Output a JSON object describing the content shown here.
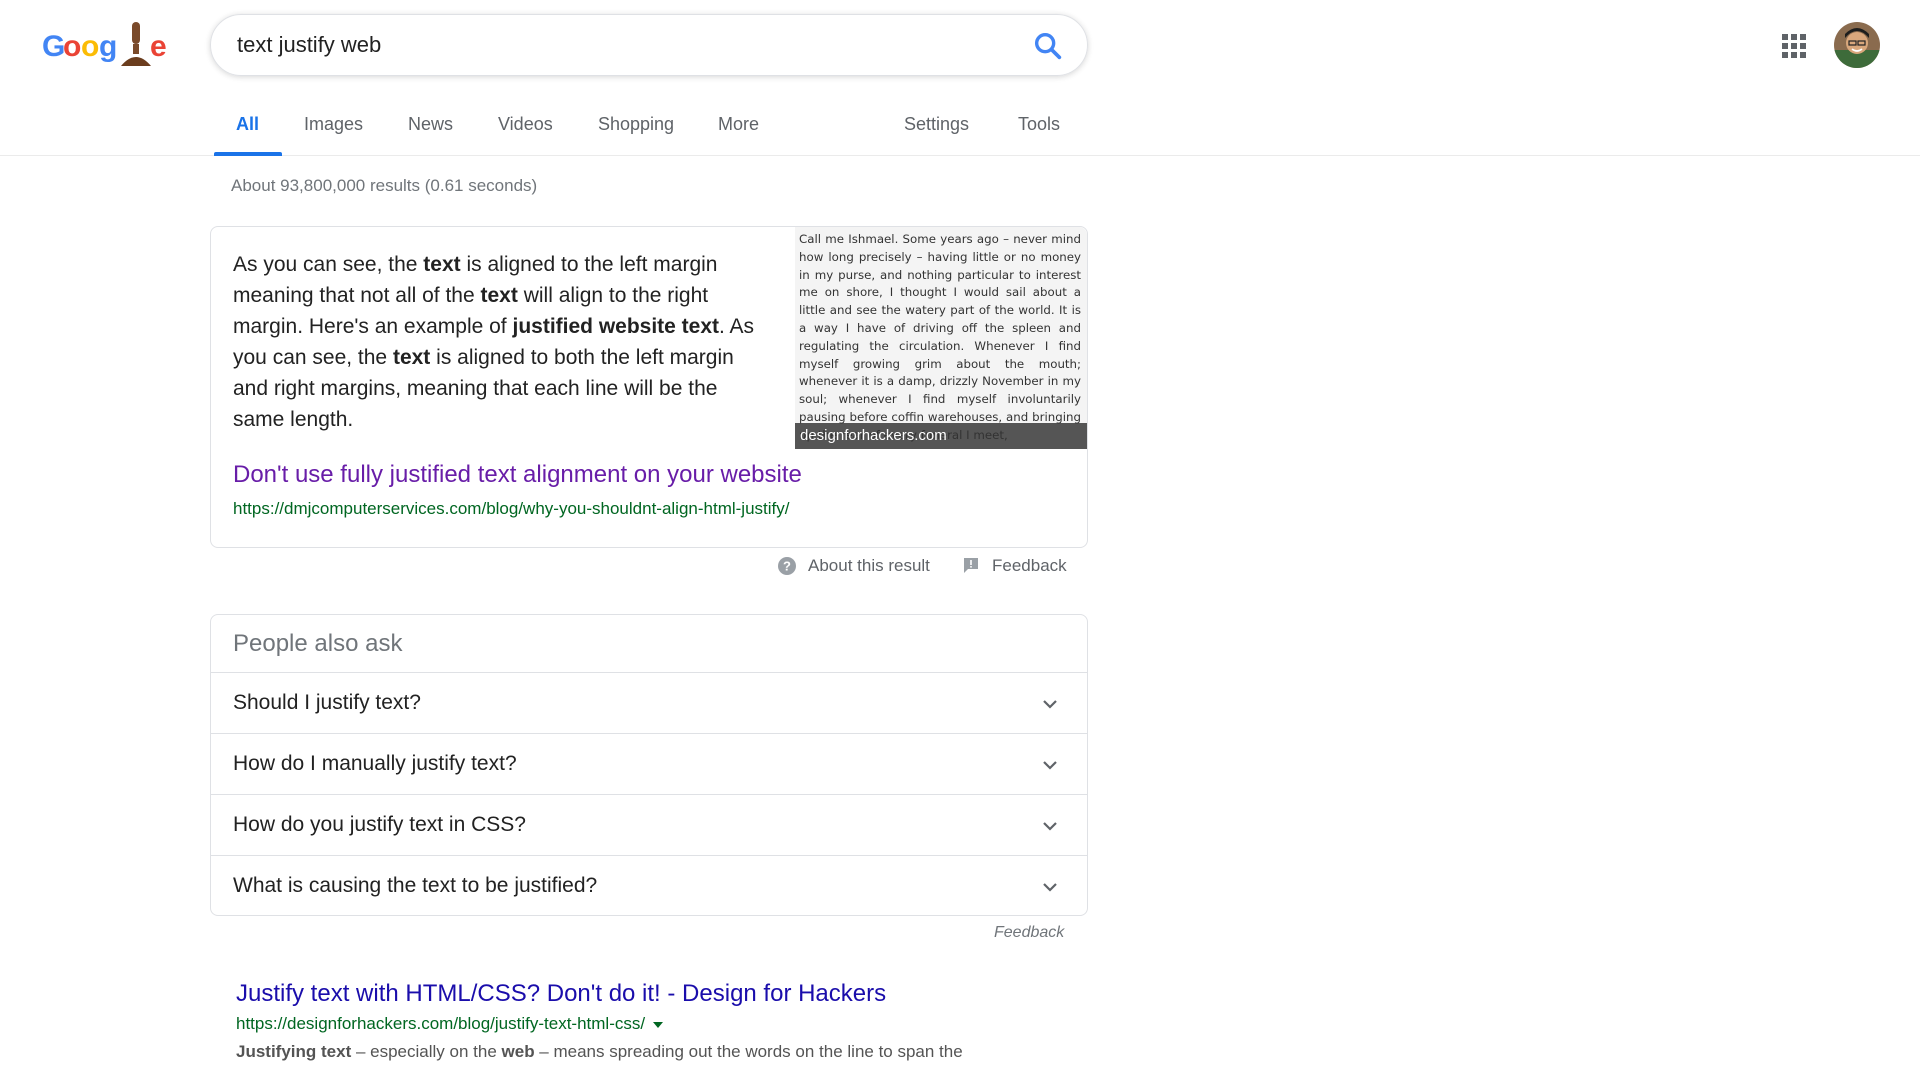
{
  "search": {
    "query": "text justify web"
  },
  "tabs": [
    {
      "label": "All"
    },
    {
      "label": "Images"
    },
    {
      "label": "News"
    },
    {
      "label": "Videos"
    },
    {
      "label": "Shopping"
    },
    {
      "label": "More"
    },
    {
      "label": "Settings"
    },
    {
      "label": "Tools"
    }
  ],
  "stats": "About 93,800,000 results (0.61 seconds)",
  "featured": {
    "parts": [
      {
        "text": "As you can see, the ",
        "bold": false
      },
      {
        "text": "text",
        "bold": true
      },
      {
        "text": " is aligned to the left margin meaning that not all of the ",
        "bold": false
      },
      {
        "text": "text",
        "bold": true
      },
      {
        "text": " will align to the right margin. Here's an example of ",
        "bold": false
      },
      {
        "text": "justified website text",
        "bold": true
      },
      {
        "text": ". As you can see, the ",
        "bold": false
      },
      {
        "text": "text",
        "bold": true
      },
      {
        "text": " is aligned to both the left margin and right margins, meaning that each line will be the same length.",
        "bold": false
      }
    ],
    "image_text": "Call me Ishmael. Some years ago – never mind how long precisely – having little or no money in my purse, and nothing particular to interest me on shore, I thought I would sail about a little and see the watery part of the world. It is a way I have of driving off the spleen and regulating the circulation. Whenever I find myself growing grim about the mouth; whenever it is a damp, drizzly November in my soul; whenever I find myself involuntarily pausing before coffin warehouses, and bringing up the rear of every funeral I meet,",
    "image_caption": "designforhackers.com",
    "title": "Don't use fully justified text alignment on your website",
    "url": "https://dmjcomputerservices.com/blog/why-you-shouldnt-align-html-justify/"
  },
  "about": {
    "about_label": "About this result",
    "feedback_label": "Feedback"
  },
  "paa": {
    "heading": "People also ask",
    "questions": [
      "Should I justify text?",
      "How do I manually justify text?",
      "How do you justify text in CSS?",
      "What is causing the text to be justified?"
    ],
    "feedback_label": "Feedback"
  },
  "result": {
    "title": "Justify text with HTML/CSS? Don't do it! - Design for Hackers",
    "url": "https://designforhackers.com/blog/justify-text-html-css/",
    "snippet_parts": [
      {
        "text": "Justifying text",
        "bold": true
      },
      {
        "text": " – especially on the ",
        "bold": false
      },
      {
        "text": "web",
        "bold": true
      },
      {
        "text": " – means spreading out the words on the line to span the",
        "bold": false
      }
    ]
  },
  "colors": {
    "accent": "#1a73e8",
    "visited_link": "#681da8",
    "link": "#1a0dab",
    "url_green": "#006621"
  }
}
